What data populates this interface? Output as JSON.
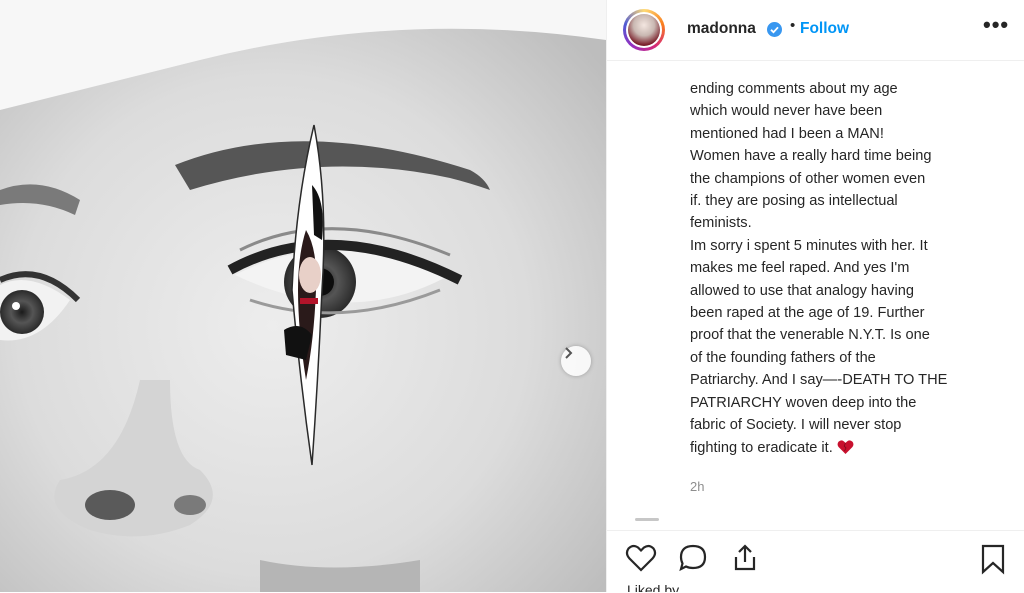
{
  "post": {
    "username": "madonna",
    "separator": "•",
    "follow_label": "Follow",
    "more_label": "•••",
    "caption_lines": [
      "ending comments about my age",
      "which would never have been",
      "mentioned had I been a MAN!",
      "Women have a really hard time being",
      "the champions of other women even",
      "if. they are posing as intellectual",
      "feminists.",
      "Im sorry i spent 5 minutes with her. It",
      "makes me feel raped. And yes I'm",
      "allowed to use that analogy having",
      "been raped at the age of 19. Further",
      "proof that the venerable N.Y.T. Is one",
      "of the founding fathers of the",
      "Patriarchy. And I say—-DEATH TO THE",
      "PATRIARCHY woven deep into the",
      "fabric of Society. I will never stop",
      "fighting to eradicate it."
    ],
    "timestamp": "2h",
    "likes_text": "Liked by ..."
  },
  "icons": {
    "verified": "verified-badge-icon",
    "next": "chevron-right-icon",
    "like": "heart-outline-icon",
    "comment": "comment-bubble-icon",
    "share": "share-upload-icon",
    "save": "bookmark-icon",
    "emoji": "red-heart-emoji"
  },
  "colors": {
    "accent": "#0095f6",
    "text": "#262626",
    "muted": "#8e8e8e",
    "heart": "#c8102e"
  }
}
